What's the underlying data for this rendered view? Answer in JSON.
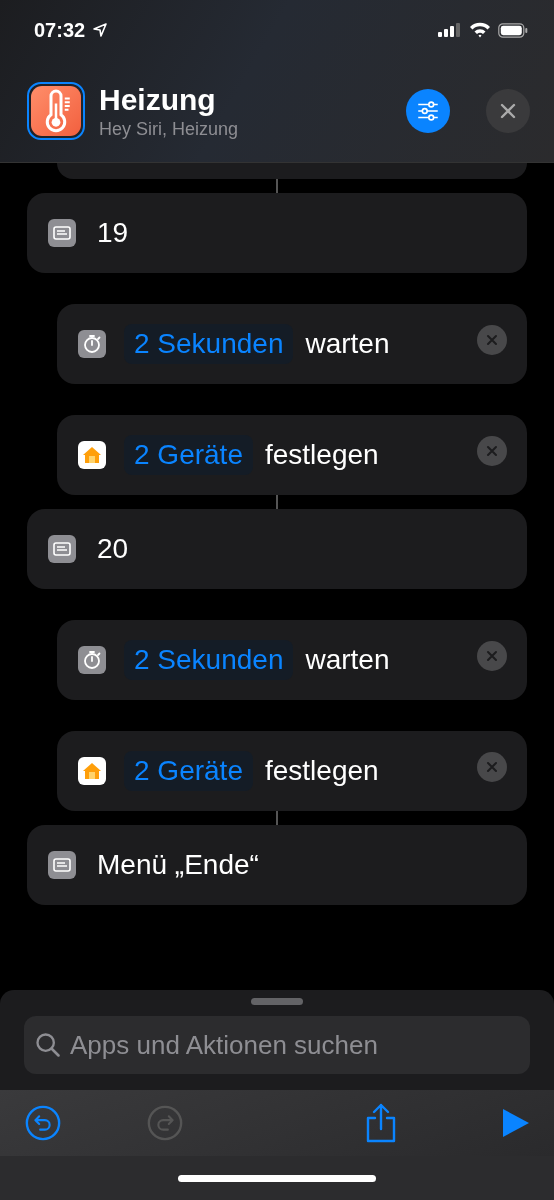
{
  "status_bar": {
    "time": "07:32"
  },
  "header": {
    "title": "Heizung",
    "subtitle": "Hey Siri, Heizung"
  },
  "actions": [
    {
      "kind": "menu",
      "label": "19"
    },
    {
      "kind": "wait",
      "param": "2 Sekunden",
      "verb": "warten"
    },
    {
      "kind": "home",
      "param": "2 Geräte",
      "verb": "festlegen"
    },
    {
      "kind": "menu",
      "label": "20"
    },
    {
      "kind": "wait",
      "param": "2 Sekunden",
      "verb": "warten"
    },
    {
      "kind": "home",
      "param": "2 Geräte",
      "verb": "festlegen"
    },
    {
      "kind": "menu",
      "label": "Menü „Ende“"
    }
  ],
  "search": {
    "placeholder": "Apps und Aktionen suchen"
  },
  "toolbar": [
    {
      "kind": "undo",
      "disabled": false
    },
    {
      "kind": "redo",
      "disabled": true
    },
    {
      "kind": "share",
      "disabled": false
    },
    {
      "kind": "run",
      "disabled": false
    }
  ]
}
